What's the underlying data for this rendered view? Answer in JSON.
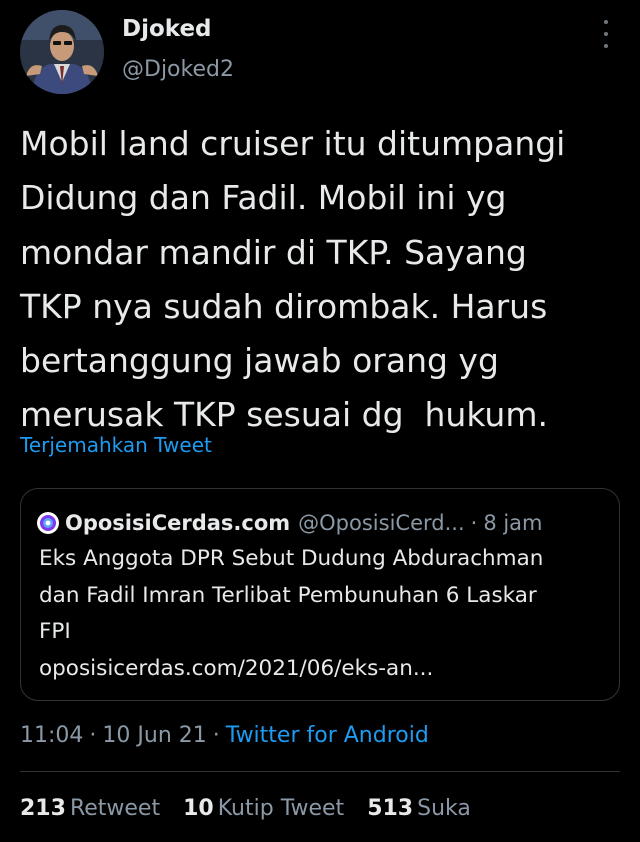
{
  "author": {
    "display_name": "Djoked",
    "handle": "@Djoked2",
    "avatar_icon": "profile-photo"
  },
  "more_icon": "vertical-ellipsis-icon",
  "tweet": {
    "text": "Mobil land cruiser itu ditumpangi\nDidung dan Fadil. Mobil ini yg\nmondar mandir di TKP. Sayang\nTKP nya sudah dirombak. Harus\nbertanggung jawab orang yg\nmerusak TKP sesuai dg  hukum.",
    "translate_label": "Terjemahkan Tweet"
  },
  "quoted_tweet": {
    "name": "OposisiCerdas.com",
    "handle": "@OposisiCerd...",
    "separator": "·",
    "time": "8 jam",
    "text": "Eks Anggota DPR Sebut Dudung Abdurachman\ndan Fadil Imran Terlibat Pembunuhan 6 Laskar\nFPI\noposisicerdas.com/2021/06/eks-an...",
    "avatar_icon": "oposisicerdas-logo-icon"
  },
  "meta": {
    "time": "11:04",
    "separator": "·",
    "date": "10 Jun 21",
    "source": "Twitter for Android"
  },
  "stats": {
    "retweets": {
      "count": "213",
      "label": "Retweet"
    },
    "quotes": {
      "count": "10",
      "label": "Kutip Tweet"
    },
    "likes": {
      "count": "513",
      "label": "Suka"
    }
  },
  "colors": {
    "background": "#000000",
    "text": "#e7e9ea",
    "secondary": "#8b98a5",
    "link": "#1d9bf0",
    "border": "#2f3336"
  }
}
